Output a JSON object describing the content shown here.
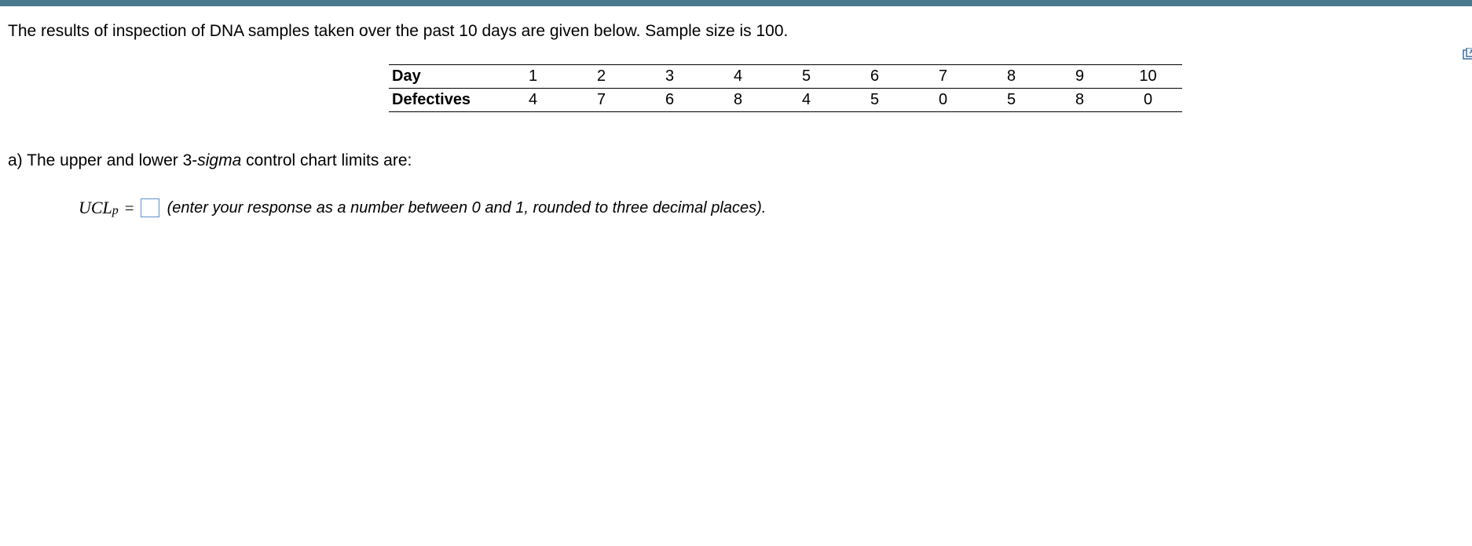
{
  "intro": "The results of inspection of DNA samples taken over the past 10 days are given below. Sample size is 100.",
  "table": {
    "dayLabel": "Day",
    "defectivesLabel": "Defectives",
    "days": [
      "1",
      "2",
      "3",
      "4",
      "5",
      "6",
      "7",
      "8",
      "9",
      "10"
    ],
    "defectives": [
      "4",
      "7",
      "6",
      "8",
      "4",
      "5",
      "0",
      "5",
      "8",
      "0"
    ]
  },
  "question": {
    "prefix": "a) The upper and lower 3-",
    "sigma": "sigma",
    "suffix": " control chart limits are:",
    "uclLabel": "UCL",
    "uclSub": "p",
    "equals": "=",
    "hint": "(enter your response as a number between 0 and 1, rounded to three decimal places)."
  }
}
